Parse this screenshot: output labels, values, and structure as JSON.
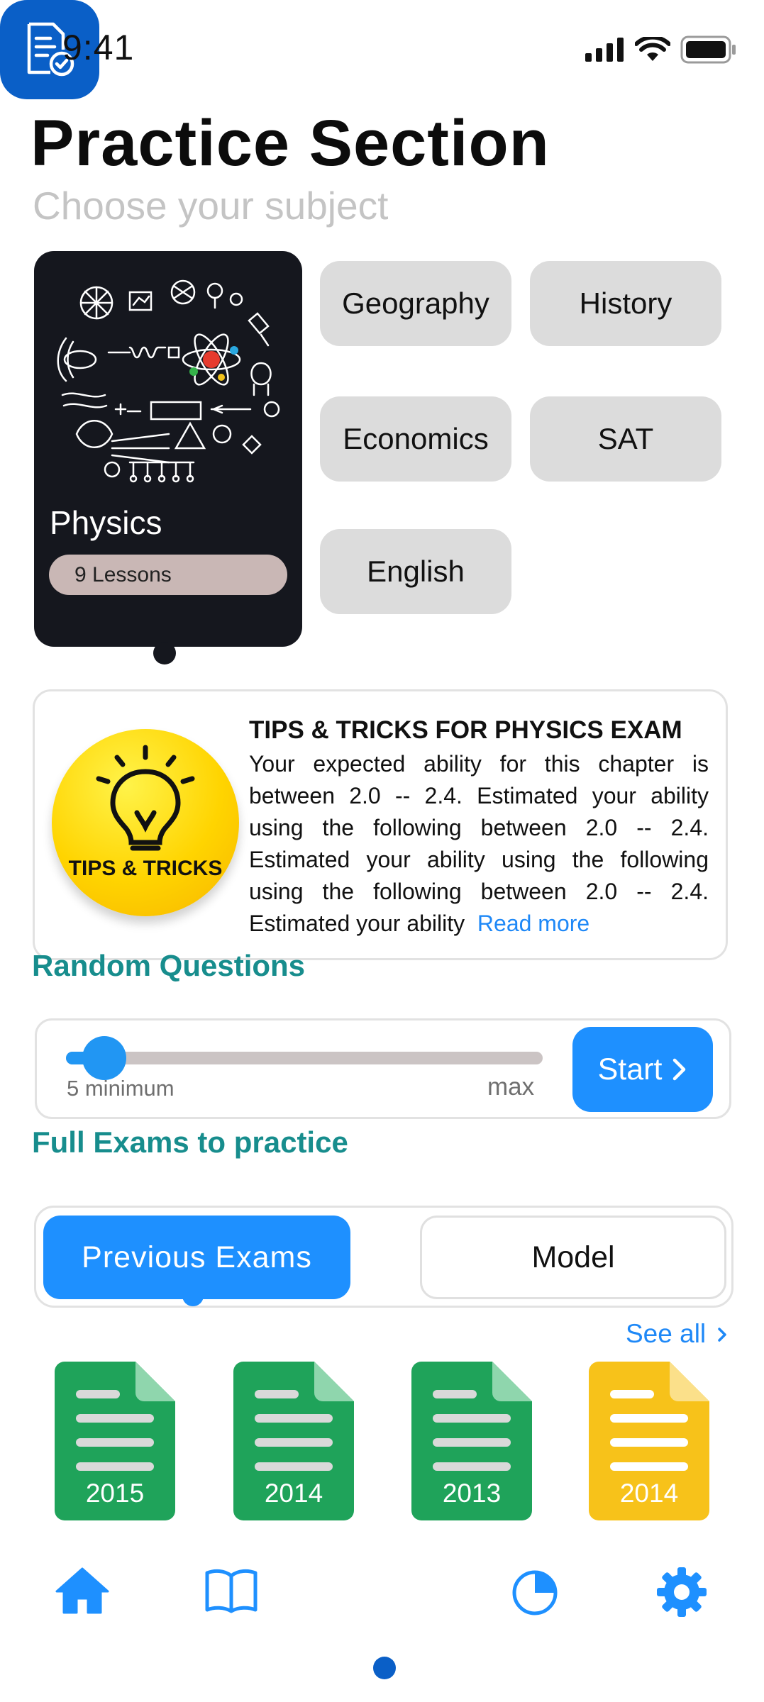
{
  "status_bar": {
    "time": "9:41"
  },
  "header": {
    "title": "Practice Section",
    "subtitle": "Choose your subject"
  },
  "featured_subject": {
    "name": "Physics",
    "lessons": "9 Lessons"
  },
  "subjects": [
    "Geography",
    "History",
    "Economics",
    "SAT",
    "English"
  ],
  "tips": {
    "badge_text": "TIPS & TRICKS",
    "title": "TIPS & TRICKS FOR PHYSICS EXAM",
    "body": "Your expected ability for this chapter is between 2.0 -- 2.4. Estimated your ability using the following between 2.0 -- 2.4. Estimated your ability using the following using the following between 2.0 -- 2.4. Estimated your ability",
    "read_more": "Read more"
  },
  "random_questions": {
    "heading": "Random Questions",
    "min_label": "5 minimum",
    "max_label": "max",
    "slider_fraction": 0.08,
    "start_label": "Start"
  },
  "full_exams": {
    "heading": "Full Exams to practice",
    "tabs": [
      {
        "label": "Previous Exams",
        "active": true
      },
      {
        "label": "Model",
        "active": false
      }
    ],
    "see_all": "See all",
    "exams": [
      {
        "year": "2015",
        "color": "#1fa35a"
      },
      {
        "year": "2014",
        "color": "#1fa35a"
      },
      {
        "year": "2013",
        "color": "#1fa35a"
      },
      {
        "year": "2014",
        "color": "#f7c21a"
      }
    ]
  },
  "bottom_nav": {
    "items": [
      {
        "icon": "home-icon",
        "active": false
      },
      {
        "icon": "book-icon",
        "active": false
      },
      {
        "icon": "exam-document-icon",
        "active": true
      },
      {
        "icon": "pie-chart-icon",
        "active": false
      },
      {
        "icon": "settings-gear-icon",
        "active": false
      }
    ]
  },
  "colors": {
    "accent": "#1e90ff",
    "teal_heading": "#178d8d",
    "nav_active": "#0a5fc7",
    "chip_bg": "#dcdcdc"
  }
}
